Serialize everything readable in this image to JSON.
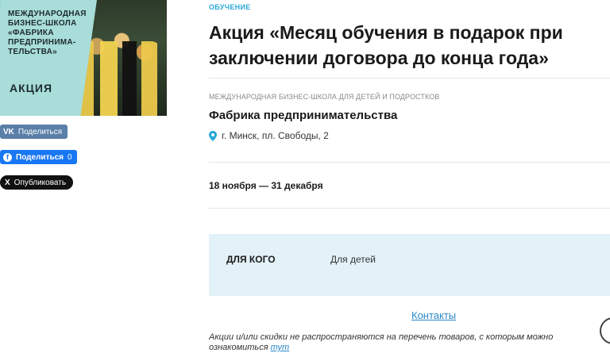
{
  "promo": {
    "text": "МЕЖДУНАРОДНАЯ БИЗНЕС-ШКОЛА «ФАБРИКА ПРЕДПРИНИМА-ТЕЛЬСТВА»",
    "badge": "АКЦИЯ"
  },
  "share": {
    "vk_icon": "VK",
    "vk_label": "Поделиться",
    "fb_icon": "f",
    "fb_label": "Поделиться",
    "fb_count": "0",
    "x_icon": "X",
    "x_label": "Опубликовать"
  },
  "article": {
    "category": "ОБУЧЕНИЕ",
    "title": "Акция «Месяц обучения в подарок при заключении договора до конца года»",
    "org_caption": "МЕЖДУНАРОДНАЯ БИЗНЕС-ШКОЛА ДЛЯ ДЕТЕЙ И ПОДРОСТКОВ",
    "org_name": "Фабрика предпринимательства",
    "address": "г. Минск, пл. Свободы, 2",
    "dates": "18 ноября — 31 декабря",
    "audience_label": "ДЛЯ КОГО",
    "audience_value": "Для детей",
    "contacts_link": "Контакты",
    "disclaimer_text": "Акции и/или скидки не распространяются на перечень товаров, с которым можно ознакомиться",
    "disclaimer_link": "тут"
  },
  "colors": {
    "accent": "#2aa7d9",
    "link": "#2a87c8",
    "info_bg": "#e3f2f8",
    "vk": "#5a7fa8",
    "fb": "#1877f2"
  }
}
